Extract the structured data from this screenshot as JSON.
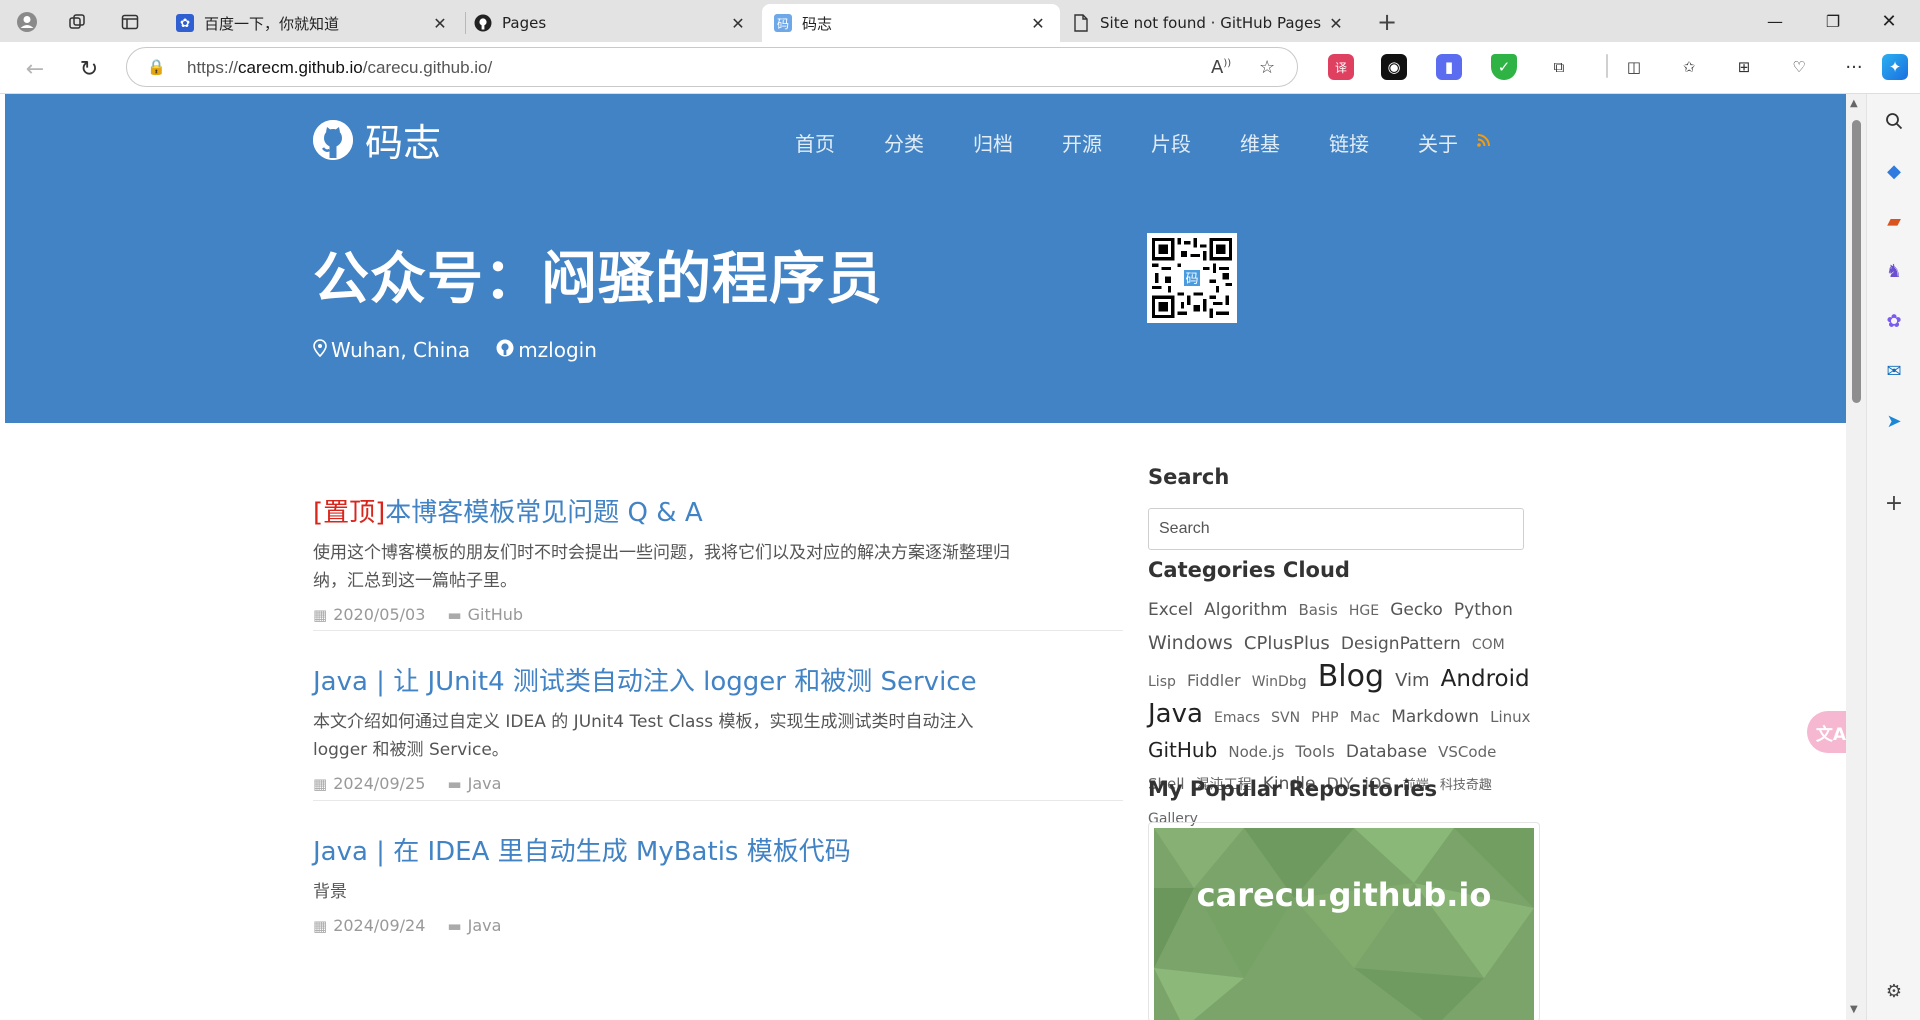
{
  "browser": {
    "tabs": [
      {
        "title": "百度一下，你就知道",
        "icon": "baidu-paw-icon"
      },
      {
        "title": "Pages",
        "icon": "github-icon"
      },
      {
        "title": "码志",
        "icon": "site-favicon",
        "active": true
      },
      {
        "title": "Site not found · GitHub Pages",
        "icon": "page-icon"
      }
    ],
    "url_prefix": "https://",
    "url_host": "carecm.github.io",
    "url_path": "/carecu.github.io/"
  },
  "site": {
    "name": "码志",
    "nav": [
      "首页",
      "分类",
      "归档",
      "开源",
      "片段",
      "维基",
      "链接",
      "关于"
    ],
    "hero_title": "公众号：闷骚的程序员",
    "location": "Wuhan, China",
    "github_user": "mzlogin"
  },
  "posts": [
    {
      "pin": "[置顶]",
      "title": "本博客模板常见问题 Q & A",
      "excerpt": "使用这个博客模板的朋友们时不时会提出一些问题，我将它们以及对应的解决方案逐渐整理归纳，汇总到这一篇帖子里。",
      "date": "2020/05/03",
      "category": "GitHub"
    },
    {
      "pin": "",
      "title": "Java | 让 JUnit4 测试类自动注入 logger 和被测 Service",
      "excerpt": "本文介绍如何通过自定义 IDEA 的 JUnit4 Test Class 模板，实现生成测试类时自动注入 logger 和被测 Service。",
      "date": "2024/09/25",
      "category": "Java"
    },
    {
      "pin": "",
      "title": "Java | 在 IDEA 里自动生成 MyBatis 模板代码",
      "excerpt": "背景",
      "date": "2024/09/24",
      "category": "Java"
    }
  ],
  "sidebar": {
    "search_heading": "Search",
    "search_placeholder": "Search",
    "categories_heading": "Categories Cloud",
    "categories": [
      {
        "name": "Excel",
        "size": 17
      },
      {
        "name": "Algorithm",
        "size": 17
      },
      {
        "name": "Basis",
        "size": 15
      },
      {
        "name": "HGE",
        "size": 14
      },
      {
        "name": "Gecko",
        "size": 17
      },
      {
        "name": "Python",
        "size": 17
      },
      {
        "name": "Windows",
        "size": 19
      },
      {
        "name": "CPlusPlus",
        "size": 18
      },
      {
        "name": "DesignPattern",
        "size": 17
      },
      {
        "name": "COM",
        "size": 14
      },
      {
        "name": "Lisp",
        "size": 14
      },
      {
        "name": "Fiddler",
        "size": 16
      },
      {
        "name": "WinDbg",
        "size": 14
      },
      {
        "name": "Blog",
        "size": 30
      },
      {
        "name": "Vim",
        "size": 18
      },
      {
        "name": "Android",
        "size": 23
      },
      {
        "name": "Java",
        "size": 26
      },
      {
        "name": "Emacs",
        "size": 14
      },
      {
        "name": "SVN",
        "size": 14
      },
      {
        "name": "PHP",
        "size": 14
      },
      {
        "name": "Mac",
        "size": 15
      },
      {
        "name": "Markdown",
        "size": 17
      },
      {
        "name": "Linux",
        "size": 15
      },
      {
        "name": "GitHub",
        "size": 20
      },
      {
        "name": "Node.js",
        "size": 15
      },
      {
        "name": "Tools",
        "size": 16
      },
      {
        "name": "Database",
        "size": 17
      },
      {
        "name": "VSCode",
        "size": 15
      },
      {
        "name": "Shell",
        "size": 15
      },
      {
        "name": "混沌工程",
        "size": 14
      },
      {
        "name": "Kindle",
        "size": 17
      },
      {
        "name": "DIY",
        "size": 16
      },
      {
        "name": "iOS",
        "size": 16
      },
      {
        "name": "前端",
        "size": 13
      },
      {
        "name": "科技奇趣",
        "size": 13
      },
      {
        "name": "Gallery",
        "size": 14
      }
    ],
    "repos_heading": "My Popular Repositories",
    "repo_card_text": "carecu.github.io"
  },
  "colors": {
    "accent": "#4183c4",
    "pin_red": "#d9261c",
    "repo_green": "#7aa469"
  }
}
